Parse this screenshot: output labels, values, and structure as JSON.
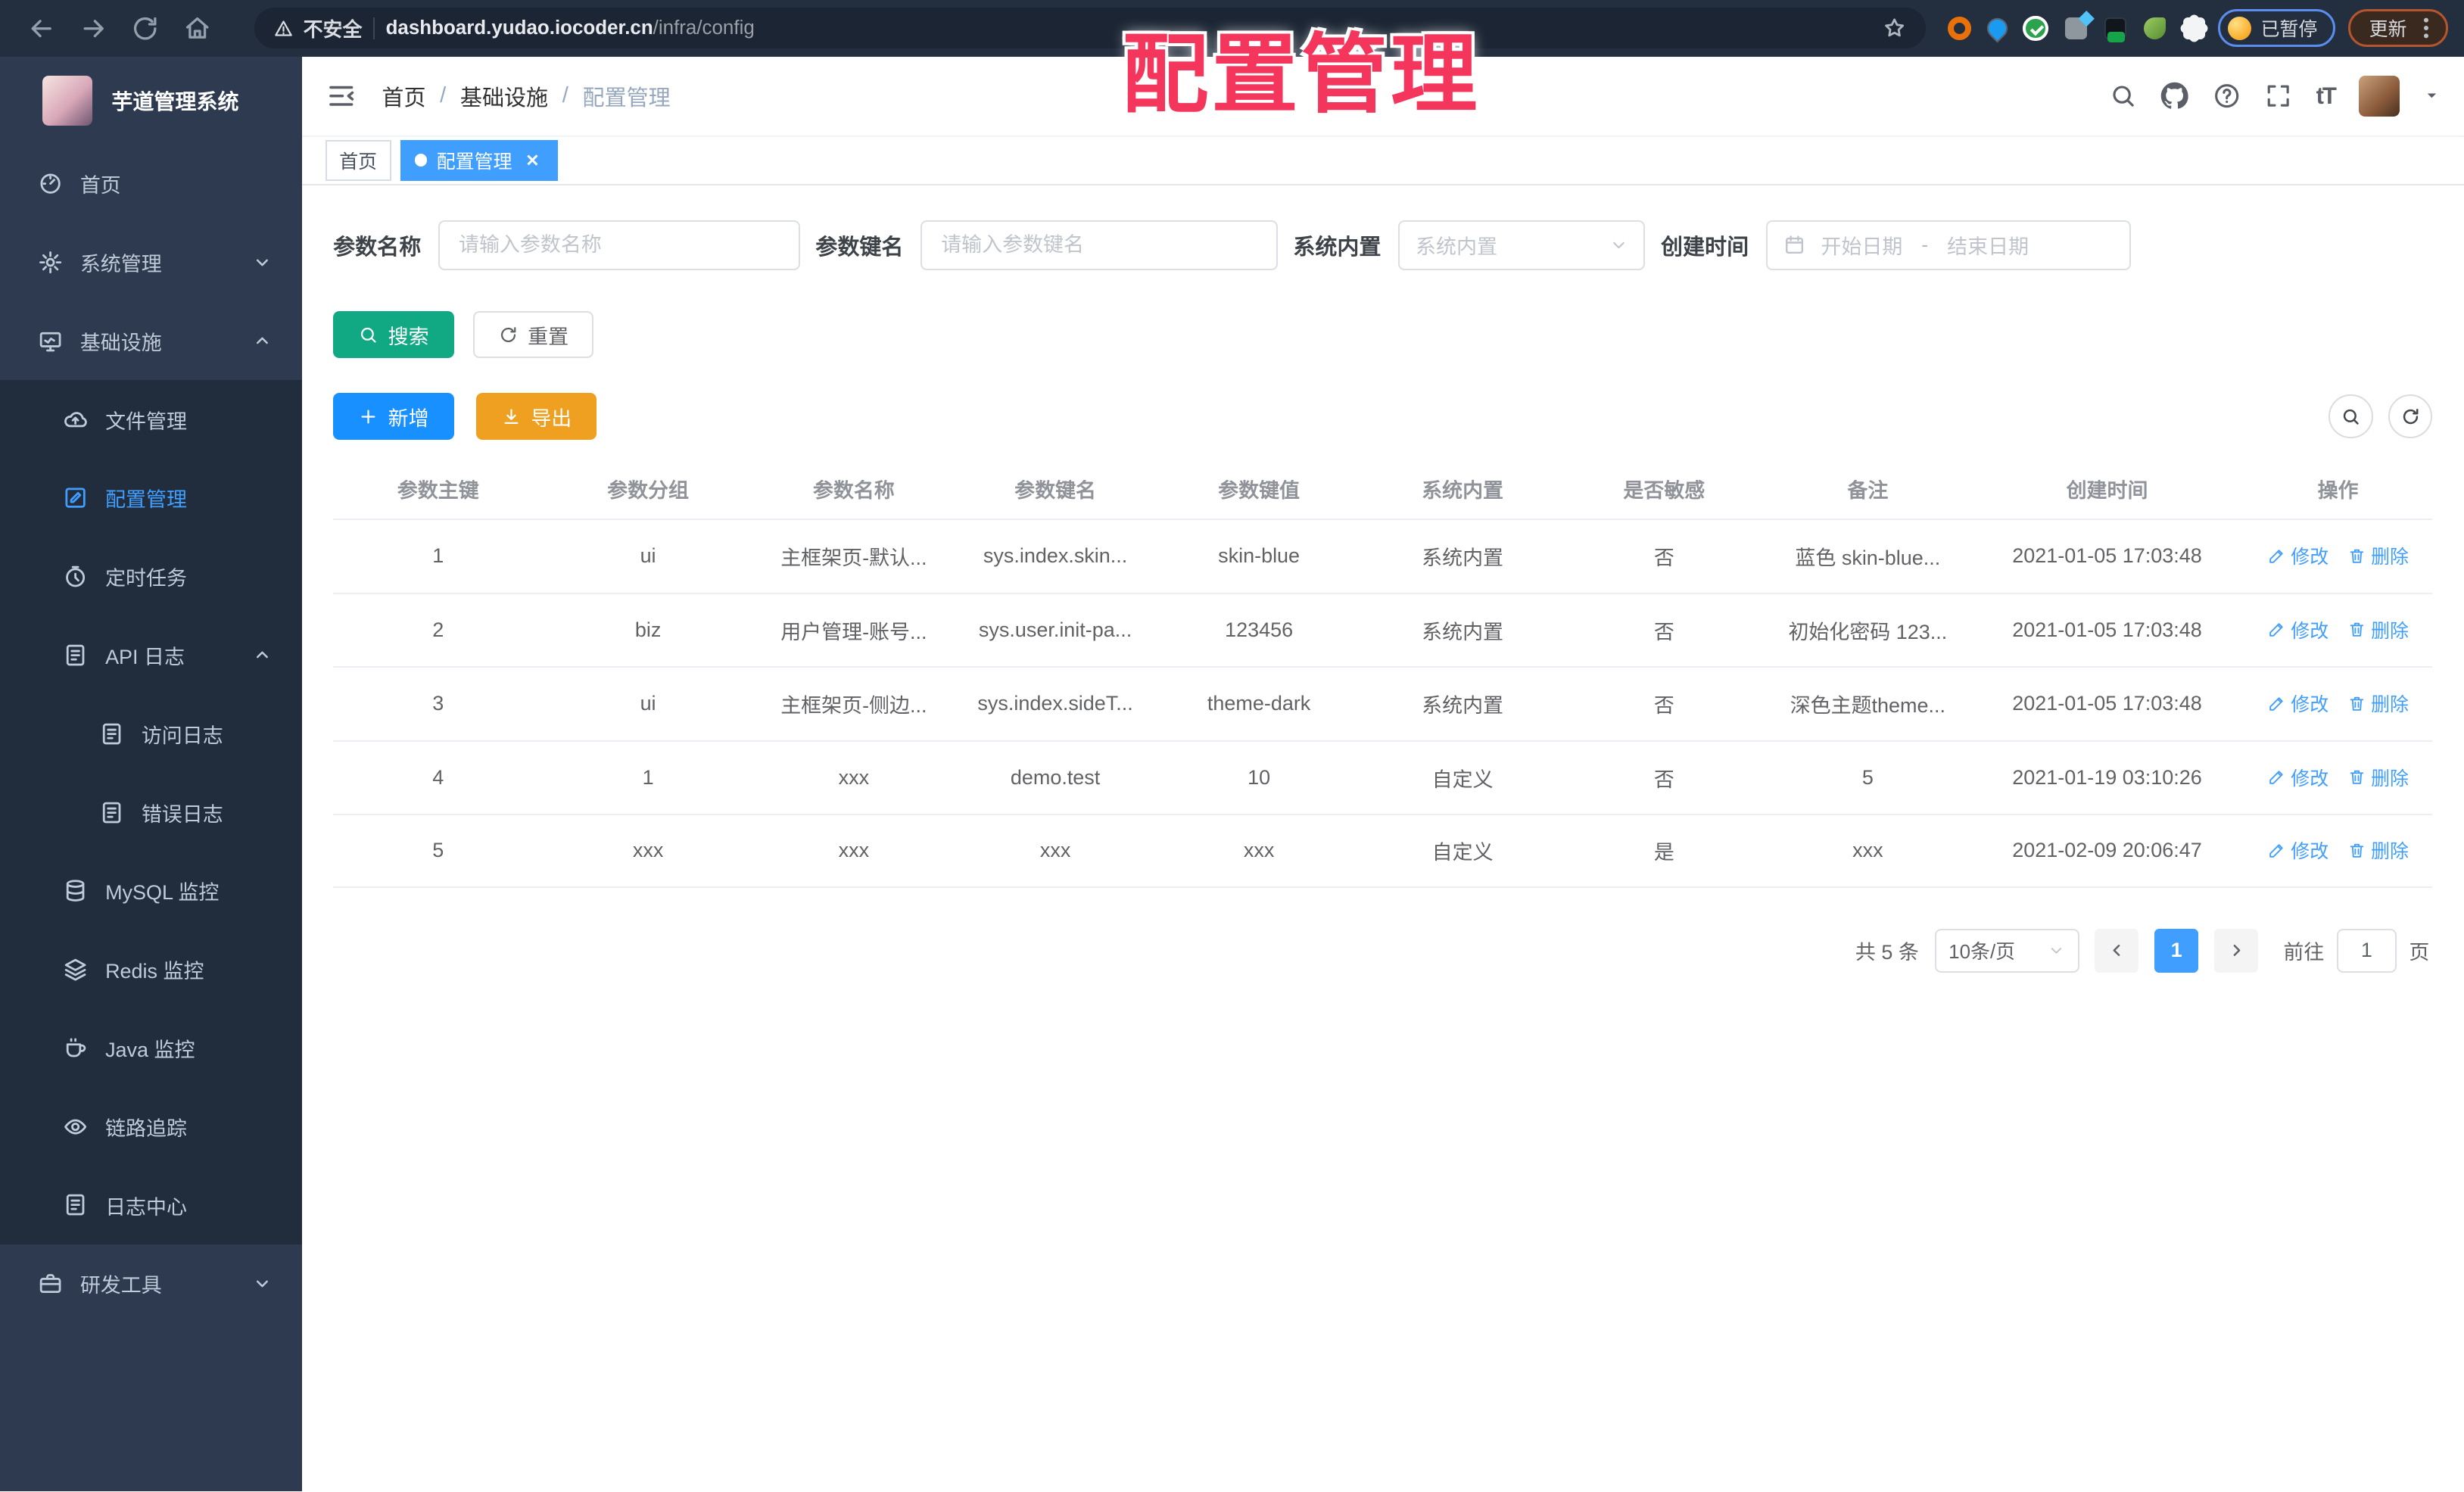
{
  "watermark": "配置管理",
  "colors": {
    "accent": "#409EFF",
    "search_button": "#11A983",
    "add_button": "#1890FF",
    "export_button": "#F0A020",
    "watermark_red": "#F5365C",
    "sidebar_bg": "#2E3A50",
    "submenu_bg": "#212C3D",
    "browser_bar_bg": "#232E3E"
  },
  "browser": {
    "security_label": "不安全",
    "url_host": "dashboard.yudao.iocoder.cn",
    "url_path": "/infra/config",
    "paused_badge": "已暂停",
    "update_label": "更新"
  },
  "sidebar": {
    "logo_title": "芋道管理系统",
    "items": [
      {
        "label": "首页",
        "icon": "gauge-icon",
        "level": 1
      },
      {
        "label": "系统管理",
        "icon": "gear-icon",
        "level": 1,
        "arrow": "down"
      },
      {
        "label": "基础设施",
        "icon": "infra-icon",
        "level": 1,
        "arrow": "up"
      },
      {
        "label": "文件管理",
        "icon": "cloud-upload-icon",
        "level": 2
      },
      {
        "label": "配置管理",
        "icon": "edit-square-icon",
        "level": 2,
        "active": true
      },
      {
        "label": "定时任务",
        "icon": "timer-icon",
        "level": 2
      },
      {
        "label": "API 日志",
        "icon": "log-icon",
        "level": 2,
        "arrow": "up"
      },
      {
        "label": "访问日志",
        "icon": "log-icon",
        "level": 3
      },
      {
        "label": "错误日志",
        "icon": "log-icon",
        "level": 3
      },
      {
        "label": "MySQL 监控",
        "icon": "database-icon",
        "level": 2
      },
      {
        "label": "Redis 监控",
        "icon": "layers-icon",
        "level": 2
      },
      {
        "label": "Java 监控",
        "icon": "coffee-icon",
        "level": 2
      },
      {
        "label": "链路追踪",
        "icon": "eye-icon",
        "level": 2
      },
      {
        "label": "日志中心",
        "icon": "log-icon",
        "level": 2
      },
      {
        "label": "研发工具",
        "icon": "toolbox-icon",
        "level": 1,
        "arrow": "down"
      }
    ]
  },
  "navbar": {
    "breadcrumb": [
      "首页",
      "基础设施",
      "配置管理"
    ],
    "font_size_glyph": "tT"
  },
  "tabs": [
    {
      "label": "首页",
      "active": false,
      "closable": false
    },
    {
      "label": "配置管理",
      "active": true,
      "closable": true
    }
  ],
  "filters": {
    "name": {
      "label": "参数名称",
      "placeholder": "请输入参数名称"
    },
    "key": {
      "label": "参数键名",
      "placeholder": "请输入参数键名"
    },
    "builtin": {
      "label": "系统内置",
      "placeholder": "系统内置"
    },
    "created": {
      "label": "创建时间",
      "start_placeholder": "开始日期",
      "separator": "-",
      "end_placeholder": "结束日期"
    }
  },
  "buttons": {
    "search": "搜索",
    "reset": "重置",
    "add": "新增",
    "export": "导出"
  },
  "table": {
    "columns": [
      "参数主键",
      "参数分组",
      "参数名称",
      "参数键名",
      "参数键值",
      "系统内置",
      "是否敏感",
      "备注",
      "创建时间",
      "操作"
    ],
    "rows": [
      {
        "id": "1",
        "group": "ui",
        "name": "主框架页-默认...",
        "key": "sys.index.skin...",
        "value": "skin-blue",
        "builtin": "系统内置",
        "sensitive": "否",
        "remark": "蓝色 skin-blue...",
        "created": "2021-01-05 17:03:48"
      },
      {
        "id": "2",
        "group": "biz",
        "name": "用户管理-账号...",
        "key": "sys.user.init-pa...",
        "value": "123456",
        "builtin": "系统内置",
        "sensitive": "否",
        "remark": "初始化密码 123...",
        "created": "2021-01-05 17:03:48"
      },
      {
        "id": "3",
        "group": "ui",
        "name": "主框架页-侧边...",
        "key": "sys.index.sideT...",
        "value": "theme-dark",
        "builtin": "系统内置",
        "sensitive": "否",
        "remark": "深色主题theme...",
        "created": "2021-01-05 17:03:48"
      },
      {
        "id": "4",
        "group": "1",
        "name": "xxx",
        "key": "demo.test",
        "value": "10",
        "builtin": "自定义",
        "sensitive": "否",
        "remark": "5",
        "created": "2021-01-19 03:10:26"
      },
      {
        "id": "5",
        "group": "xxx",
        "name": "xxx",
        "key": "xxx",
        "value": "xxx",
        "builtin": "自定义",
        "sensitive": "是",
        "remark": "xxx",
        "created": "2021-02-09 20:06:47"
      }
    ],
    "row_actions": {
      "edit": "修改",
      "delete": "删除"
    }
  },
  "pagination": {
    "total": "共 5 条",
    "page_size": "10条/页",
    "current": "1",
    "goto_label": "前往",
    "goto_value": "1",
    "unit": "页"
  }
}
